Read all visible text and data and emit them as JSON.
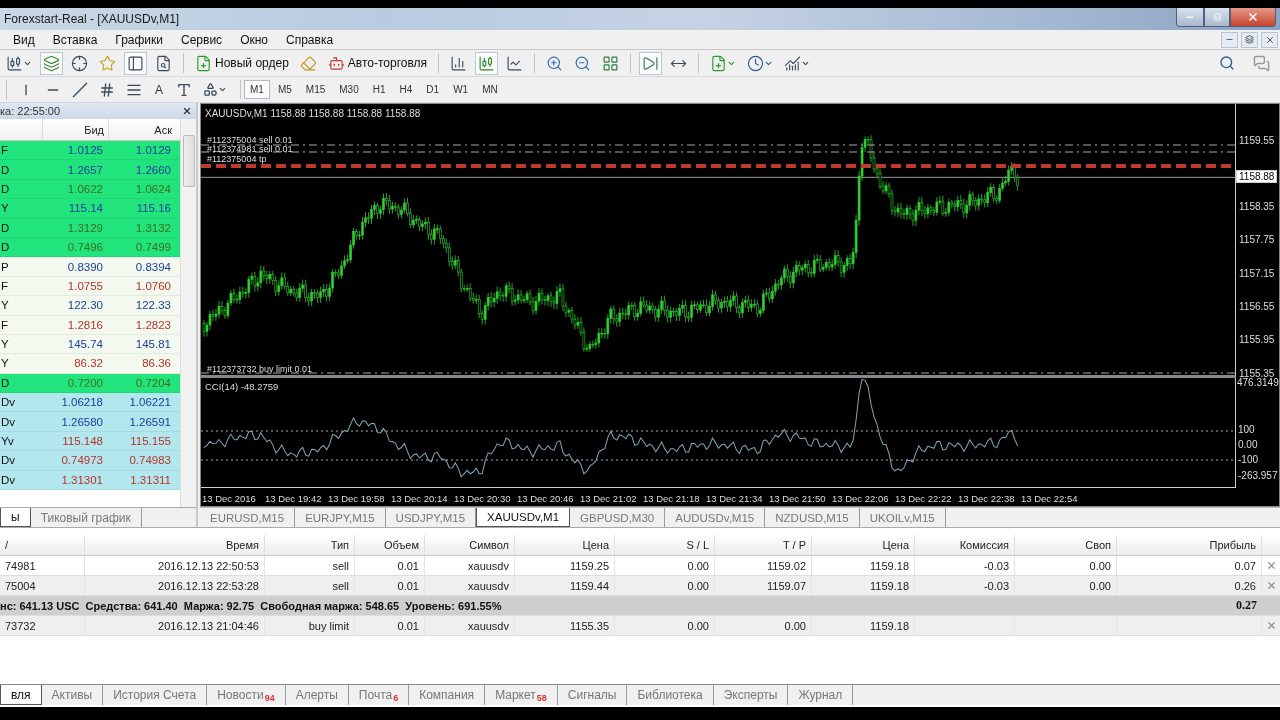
{
  "window": {
    "title": "Forexstart-Real - [XAUUSDv,M1]"
  },
  "menu": [
    "Вид",
    "Вставка",
    "Графики",
    "Сервис",
    "Окно",
    "Справка"
  ],
  "toolbar": {
    "buttons": [
      {
        "kind": "new_order",
        "label": "Новый ордер"
      },
      {
        "kind": "auto_trading",
        "label": "Авто-торговля"
      }
    ]
  },
  "drawing_tools": {
    "text_tool": "A"
  },
  "timeframes": [
    {
      "label": "M1",
      "selected": true
    },
    {
      "label": "M5",
      "selected": false
    },
    {
      "label": "M15",
      "selected": false
    },
    {
      "label": "M30",
      "selected": false
    },
    {
      "label": "H1",
      "selected": false
    },
    {
      "label": "H4",
      "selected": false
    },
    {
      "label": "D1",
      "selected": false
    },
    {
      "label": "W1",
      "selected": false
    },
    {
      "label": "MN",
      "selected": false
    }
  ],
  "market_watch": {
    "header": "ка: 22:55:00",
    "columns": [
      "Бид",
      "Аск"
    ],
    "rows": [
      {
        "symbol": "F",
        "bid": "1.0125",
        "ask": "1.0129",
        "color": "#22e47c",
        "kind": "up"
      },
      {
        "symbol": "D",
        "bid": "1.2657",
        "ask": "1.2660",
        "color": "#22e47c",
        "kind": "up"
      },
      {
        "symbol": "D",
        "bid": "1.0622",
        "ask": "1.0624",
        "color": "#22e47c",
        "kind": "flat"
      },
      {
        "symbol": "Y",
        "bid": "115.14",
        "ask": "115.16",
        "color": "#22e47c",
        "kind": "up"
      },
      {
        "symbol": "D",
        "bid": "1.3129",
        "ask": "1.3132",
        "color": "#22e47c",
        "kind": "flat"
      },
      {
        "symbol": "D",
        "bid": "0.7496",
        "ask": "0.7499",
        "color": "#22e47c",
        "kind": "flat"
      },
      {
        "symbol": "P",
        "bid": "0.8390",
        "ask": "0.8394",
        "color": "#f3f9ee",
        "kind": "up"
      },
      {
        "symbol": "F",
        "bid": "1.0755",
        "ask": "1.0760",
        "color": "#f3f9ee",
        "kind": "down"
      },
      {
        "symbol": "Y",
        "bid": "122.30",
        "ask": "122.33",
        "color": "#f3f9ee",
        "kind": "up"
      },
      {
        "symbol": "F",
        "bid": "1.2816",
        "ask": "1.2823",
        "color": "#f3f9ee",
        "kind": "down"
      },
      {
        "symbol": "Y",
        "bid": "145.74",
        "ask": "145.81",
        "color": "#f3f9ee",
        "kind": "up"
      },
      {
        "symbol": "Y",
        "bid": "86.32",
        "ask": "86.36",
        "color": "#f3f9ee",
        "kind": "down"
      },
      {
        "symbol": "D",
        "bid": "0.7200",
        "ask": "0.7204",
        "color": "#22e47c",
        "kind": "flat"
      },
      {
        "symbol": "Dv",
        "bid": "1.06218",
        "ask": "1.06221",
        "color": "#b3e7ee",
        "kind": "up"
      },
      {
        "symbol": "Dv",
        "bid": "1.26580",
        "ask": "1.26591",
        "color": "#b3e7ee",
        "kind": "up"
      },
      {
        "symbol": "Yv",
        "bid": "115.148",
        "ask": "115.155",
        "color": "#b3e7ee",
        "kind": "down"
      },
      {
        "symbol": "Dv",
        "bid": "0.74973",
        "ask": "0.74983",
        "color": "#b3e7ee",
        "kind": "down"
      },
      {
        "symbol": "Dv",
        "bid": "1.31301",
        "ask": "1.31311",
        "color": "#b3e7ee",
        "kind": "down"
      }
    ],
    "tabs": [
      {
        "label": "ы",
        "selected": true
      },
      {
        "label": "Тиковый график",
        "selected": false
      }
    ]
  },
  "chart": {
    "title": "XAUUSDv,M1  1158.88 1158.88 1158.88 1158.88",
    "order_lines": [
      {
        "kind": "sell",
        "label": "#112375004 sell 0.01"
      },
      {
        "kind": "sell",
        "label": "#112374981 sell 0.01"
      },
      {
        "kind": "take_profit",
        "label": "#112375004 tp"
      },
      {
        "kind": "buy_limit",
        "label": "#112373732 buy limit 0.01"
      }
    ],
    "price_ticks": [
      "1159.55",
      "1158.35",
      "1157.75",
      "1157.15",
      "1156.55",
      "1155.95",
      "1155.35"
    ],
    "current_price": "1158.88",
    "indicator": {
      "title": "CCI(14) -48.2759",
      "ticks": [
        "476.3149",
        "100",
        "0.00",
        "-100",
        "-263.957"
      ]
    },
    "time_ticks": [
      "13 Dec 2016",
      "13 Dec 19:42",
      "13 Dec 19:58",
      "13 Dec 20:14",
      "13 Dec 20:30",
      "13 Dec 20:46",
      "13 Dec 21:02",
      "13 Dec 21:18",
      "13 Dec 21:34",
      "13 Dec 21:50",
      "13 Dec 22:06",
      "13 Dec 22:22",
      "13 Dec 22:38",
      "13 Dec 22:54"
    ]
  },
  "chart_tabs": [
    {
      "label": "EURUSD,M15",
      "selected": false
    },
    {
      "label": "EURJPY,M15",
      "selected": false
    },
    {
      "label": "USDJPY,M15",
      "selected": false
    },
    {
      "label": "XAUUSDv,M1",
      "selected": true
    },
    {
      "label": "GBPUSD,M30",
      "selected": false
    },
    {
      "label": "AUDUSDv,M15",
      "selected": false
    },
    {
      "label": "NZDUSD,M15",
      "selected": false
    },
    {
      "label": "UKOILv,M15",
      "selected": false
    }
  ],
  "terminal": {
    "columns": [
      "/",
      "Время",
      "Тип",
      "Объем",
      "Символ",
      "Цена",
      "S / L",
      "T / P",
      "Цена",
      "Комиссия",
      "Своп",
      "Прибыль"
    ],
    "rows": [
      {
        "kind": "order",
        "cells": [
          "74981",
          "2016.12.13 22:50:53",
          "sell",
          "0.01",
          "xauusdv",
          "1159.25",
          "0.00",
          "1159.02",
          "1159.18",
          "-0.03",
          "0.00",
          "0.07"
        ]
      },
      {
        "kind": "order",
        "cells": [
          "75004",
          "2016.12.13 22:53:28",
          "sell",
          "0.01",
          "xauusdv",
          "1159.44",
          "0.00",
          "1159.07",
          "1159.18",
          "-0.03",
          "0.00",
          "0.26"
        ]
      },
      {
        "kind": "summary",
        "text": "нс: 641.13 USC  Средства: 641.40  Маржа: 92.75  Свободная маржа: 548.65  Уровень: 691.55%",
        "total": "0.27"
      },
      {
        "kind": "order",
        "cells": [
          "73732",
          "2016.12.13 21:04:46",
          "buy limit",
          "0.01",
          "xauusdv",
          "1155.35",
          "0.00",
          "0.00",
          "1159.18"
        ]
      }
    ],
    "tabs": [
      {
        "label": "вля",
        "selected": true
      },
      {
        "label": "Активы",
        "selected": false
      },
      {
        "label": "История Счета",
        "selected": false
      },
      {
        "label": "Новости",
        "badge": "94",
        "selected": false
      },
      {
        "label": "Алерты",
        "selected": false
      },
      {
        "label": "Почта",
        "badge": "6",
        "selected": false
      },
      {
        "label": "Компания",
        "selected": false
      },
      {
        "label": "Маркет",
        "badge": "58",
        "selected": false
      },
      {
        "label": "Сигналы",
        "selected": false
      },
      {
        "label": "Библиотека",
        "selected": false
      },
      {
        "label": "Эксперты",
        "selected": false
      },
      {
        "label": "Журнал",
        "selected": false
      }
    ]
  }
}
